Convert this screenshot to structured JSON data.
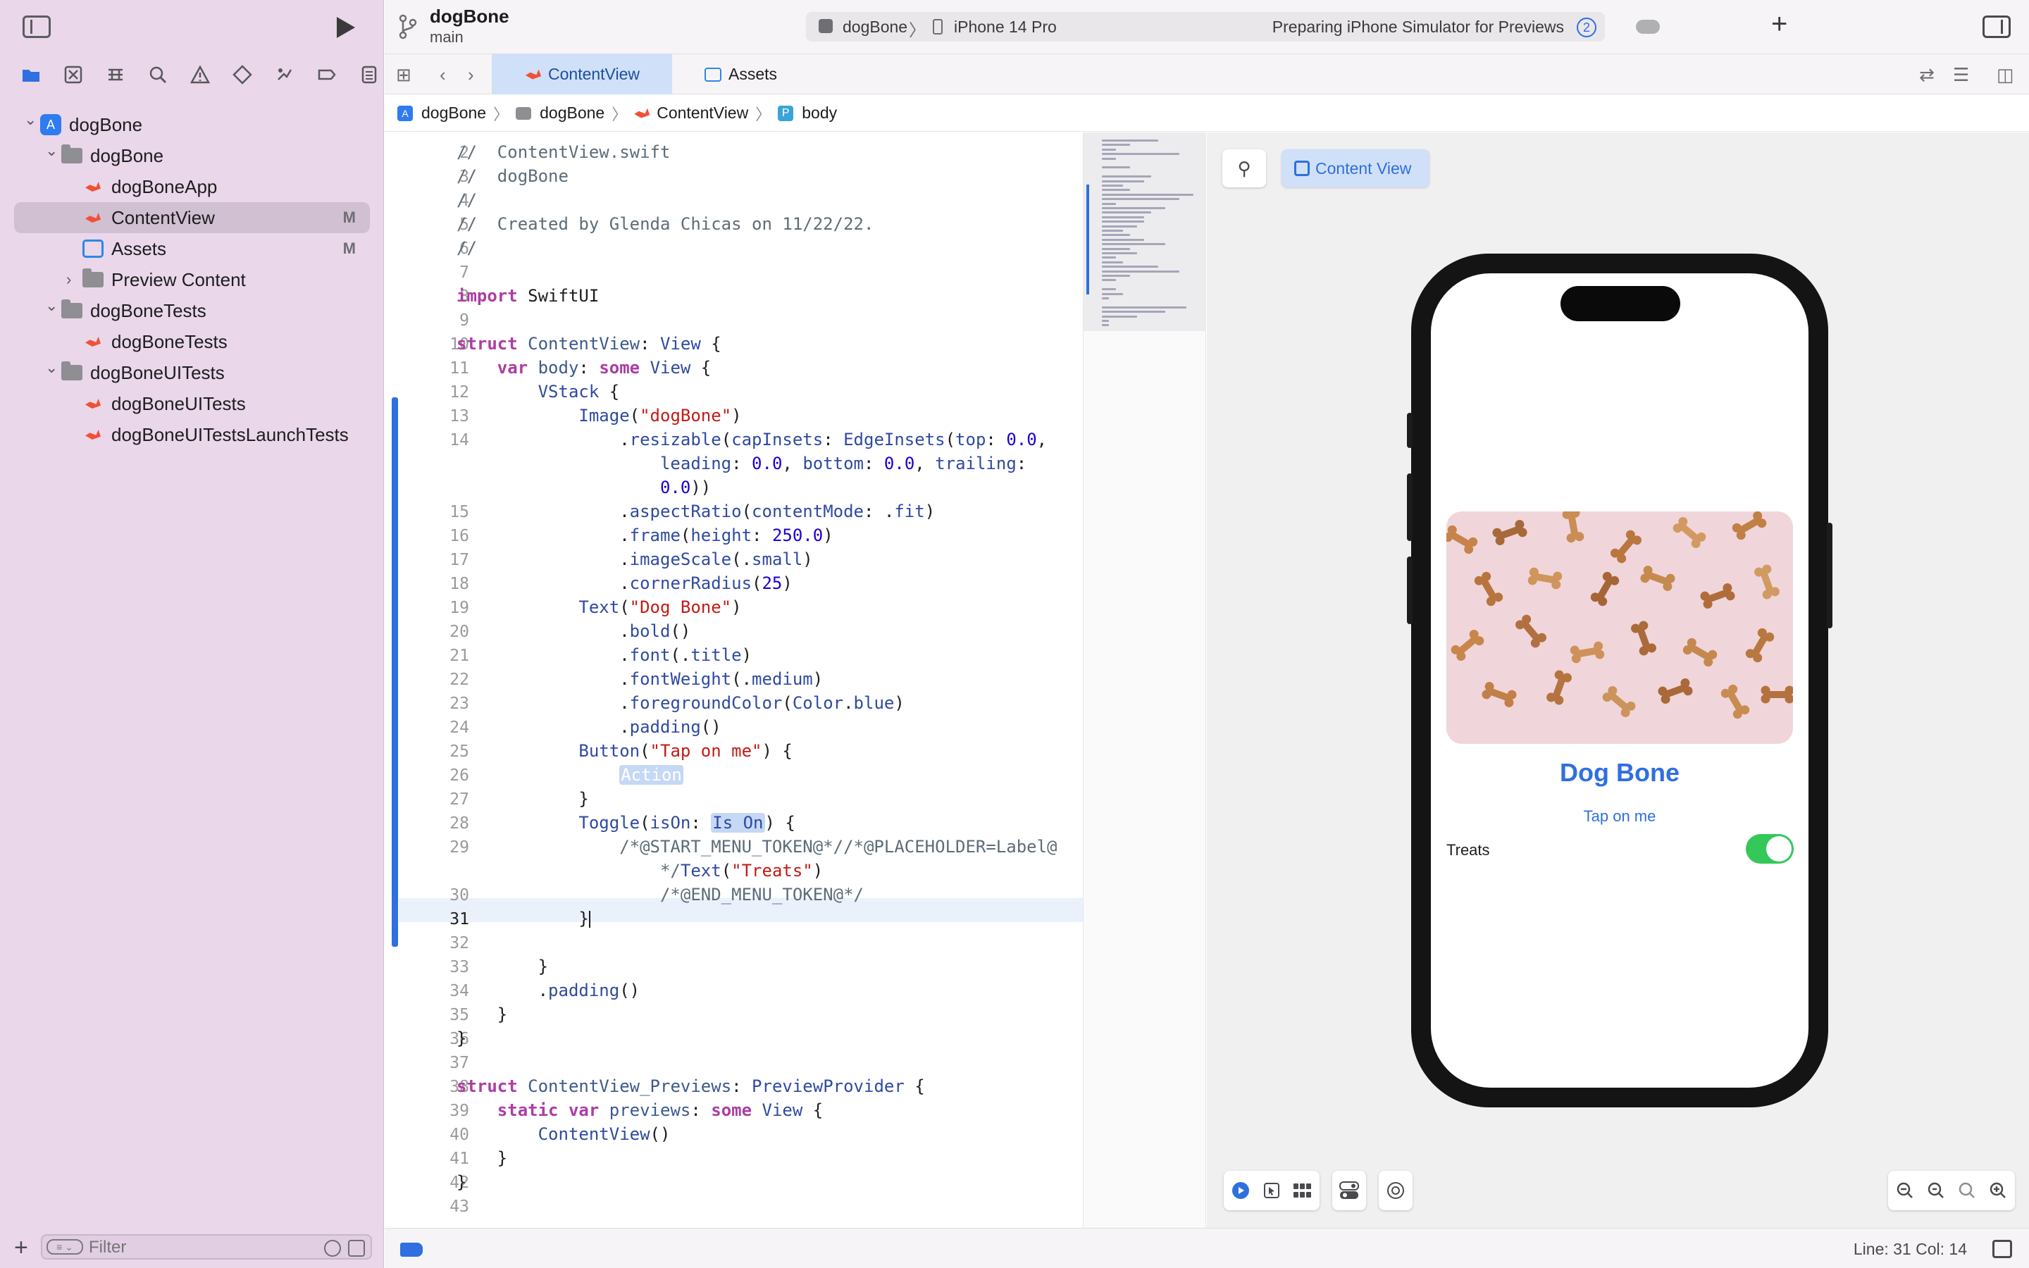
{
  "toolbar": {
    "project": "dogBone",
    "branch": "main",
    "scheme": "dogBone",
    "device": "iPhone 14 Pro",
    "status": "Preparing iPhone Simulator for Previews",
    "status_count": "2"
  },
  "navigator": {
    "tree": [
      {
        "label": "dogBone",
        "level": 0,
        "kind": "project",
        "chevron": "expanded",
        "badge": ""
      },
      {
        "label": "dogBone",
        "level": 1,
        "kind": "folder",
        "chevron": "expanded",
        "badge": ""
      },
      {
        "label": "dogBoneApp",
        "level": 2,
        "kind": "swift",
        "chevron": "",
        "badge": ""
      },
      {
        "label": "ContentView",
        "level": 2,
        "kind": "swift",
        "chevron": "",
        "badge": "M",
        "selected": true
      },
      {
        "label": "Assets",
        "level": 2,
        "kind": "assets",
        "chevron": "",
        "badge": "M"
      },
      {
        "label": "Preview Content",
        "level": 2,
        "kind": "folder",
        "chevron": "collapsed",
        "badge": ""
      },
      {
        "label": "dogBoneTests",
        "level": 1,
        "kind": "folder",
        "chevron": "expanded",
        "badge": ""
      },
      {
        "label": "dogBoneTests",
        "level": 2,
        "kind": "swift",
        "chevron": "",
        "badge": ""
      },
      {
        "label": "dogBoneUITests",
        "level": 1,
        "kind": "folder",
        "chevron": "expanded",
        "badge": ""
      },
      {
        "label": "dogBoneUITests",
        "level": 2,
        "kind": "swift",
        "chevron": "",
        "badge": ""
      },
      {
        "label": "dogBoneUITestsLaunchTests",
        "level": 2,
        "kind": "swift",
        "chevron": "",
        "badge": ""
      }
    ],
    "filter_placeholder": "Filter"
  },
  "tabs": [
    {
      "label": "ContentView",
      "active": true
    },
    {
      "label": "Assets",
      "active": false
    }
  ],
  "breadcrumb": [
    "dogBone",
    "dogBone",
    "ContentView",
    "body"
  ],
  "editor": {
    "current_line": 31,
    "lines": [
      {
        "n": "2",
        "html": "<span class=\"cm\">//  ContentView.swift</span>"
      },
      {
        "n": "3",
        "html": "<span class=\"cm\">//  dogBone</span>"
      },
      {
        "n": "4",
        "html": "<span class=\"cm\">//</span>"
      },
      {
        "n": "5",
        "html": "<span class=\"cm\">//  Created by Glenda Chicas on 11/22/22.</span>"
      },
      {
        "n": "6",
        "html": "<span class=\"cm\">//</span>"
      },
      {
        "n": "7",
        "html": ""
      },
      {
        "n": "8",
        "html": "<span class=\"kw\">import</span> SwiftUI"
      },
      {
        "n": "9",
        "html": ""
      },
      {
        "n": "10",
        "html": "<span class=\"kw\">struct</span> <span class=\"fn\">ContentView</span>: <span class=\"ty\">View</span> {"
      },
      {
        "n": "11",
        "html": "    <span class=\"kw\">var</span> <span class=\"fn\">body</span>: <span class=\"kw\">some</span> <span class=\"ty\">View</span> {"
      },
      {
        "n": "12",
        "html": "        <span class=\"ty\">VStack</span> {"
      },
      {
        "n": "13",
        "html": "            <span class=\"ty\">Image</span>(<span class=\"str\">\"dogBone\"</span>)"
      },
      {
        "n": "14",
        "html": "                .<span class=\"ty\">resizable</span>(<span class=\"ty\">capInsets</span>: <span class=\"ty\">EdgeInsets</span>(<span class=\"ty\">top</span>: <span class=\"num\">0.0</span>,"
      },
      {
        "n": "",
        "html": "                    <span class=\"ty\">leading</span>: <span class=\"num\">0.0</span>, <span class=\"ty\">bottom</span>: <span class=\"num\">0.0</span>, <span class=\"ty\">trailing</span>:"
      },
      {
        "n": "",
        "html": "                    <span class=\"num\">0.0</span>))"
      },
      {
        "n": "15",
        "html": "                .<span class=\"ty\">aspectRatio</span>(<span class=\"ty\">contentMode</span>: .<span class=\"ty\">fit</span>)"
      },
      {
        "n": "16",
        "html": "                .<span class=\"ty\">frame</span>(<span class=\"ty\">height</span>: <span class=\"num\">250.0</span>)"
      },
      {
        "n": "17",
        "html": "                .<span class=\"ty\">imageScale</span>(.<span class=\"ty\">small</span>)"
      },
      {
        "n": "18",
        "html": "                .<span class=\"ty\">cornerRadius</span>(<span class=\"num\">25</span>)"
      },
      {
        "n": "19",
        "html": "            <span class=\"ty\">Text</span>(<span class=\"str\">\"Dog Bone\"</span>)"
      },
      {
        "n": "20",
        "html": "                .<span class=\"ty\">bold</span>()"
      },
      {
        "n": "21",
        "html": "                .<span class=\"ty\">font</span>(.<span class=\"ty\">title</span>)"
      },
      {
        "n": "22",
        "html": "                .<span class=\"ty\">fontWeight</span>(.<span class=\"ty\">medium</span>)"
      },
      {
        "n": "23",
        "html": "                .<span class=\"ty\">foregroundColor</span>(<span class=\"ty\">Color</span>.<span class=\"ty\">blue</span>)"
      },
      {
        "n": "24",
        "html": "                .<span class=\"ty\">padding</span>()"
      },
      {
        "n": "25",
        "html": "            <span class=\"ty\">Button</span>(<span class=\"str\">\"Tap on me\"</span>) {"
      },
      {
        "n": "26",
        "html": "                <span class=\"ph\">Action</span>"
      },
      {
        "n": "27",
        "html": "            }"
      },
      {
        "n": "28",
        "html": "            <span class=\"ty\">Toggle</span>(<span class=\"ty\">isOn</span>: <span class=\"ph\" style=\"color:#2f4aa0\">Is On</span>) {"
      },
      {
        "n": "29",
        "html": "                <span class=\"cm\">/*@START_MENU_TOKEN@*//*@PLACEHOLDER=Label@</span>"
      },
      {
        "n": "",
        "html": "                    <span class=\"cm\">*/</span><span class=\"ty\">Text</span>(<span class=\"str\">\"Treats\"</span>)"
      },
      {
        "n": "30",
        "html": "                    <span class=\"cm\">/*@END_MENU_TOKEN@*/</span>"
      },
      {
        "n": "31",
        "html": "            }<span class=\"caret\"></span>"
      },
      {
        "n": "32",
        "html": ""
      },
      {
        "n": "33",
        "html": "        }"
      },
      {
        "n": "34",
        "html": "        .<span class=\"ty\">padding</span>()"
      },
      {
        "n": "35",
        "html": "    }"
      },
      {
        "n": "36",
        "html": "}"
      },
      {
        "n": "37",
        "html": ""
      },
      {
        "n": "38",
        "html": "<span class=\"kw\">struct</span> <span class=\"fn\">ContentView_Previews</span>: <span class=\"ty\">PreviewProvider</span> {"
      },
      {
        "n": "39",
        "html": "    <span class=\"kw\">static</span> <span class=\"kw\">var</span> <span class=\"fn\">previews</span>: <span class=\"kw\">some</span> <span class=\"ty\">View</span> {"
      },
      {
        "n": "40",
        "html": "        <span class=\"ty\">ContentView</span>()"
      },
      {
        "n": "41",
        "html": "    }"
      },
      {
        "n": "42",
        "html": "}"
      },
      {
        "n": "43",
        "html": ""
      }
    ]
  },
  "canvas": {
    "preview_label": "Content View",
    "app_title": "Dog Bone",
    "button_label": "Tap on me",
    "toggle_label": "Treats",
    "toggle_on": true,
    "accent_color": "#2f6fe0",
    "toggle_color": "#34c759"
  },
  "statusbar": {
    "position": "Line: 31  Col: 14"
  }
}
